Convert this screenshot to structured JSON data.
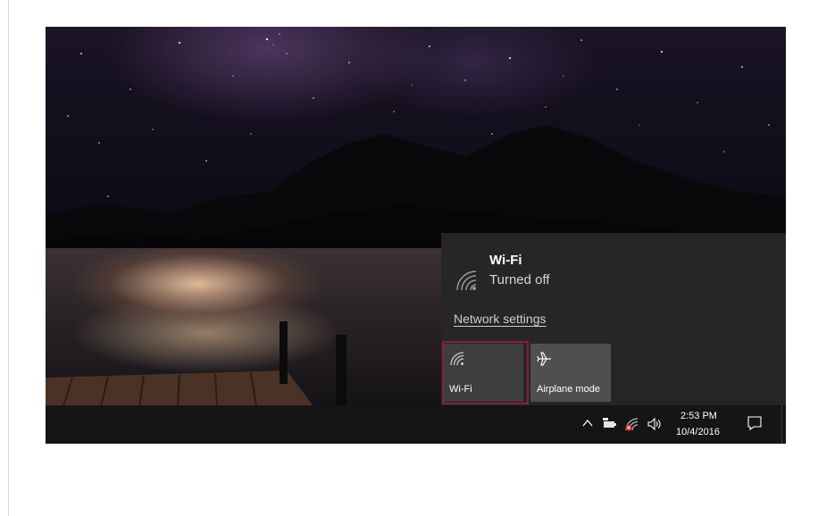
{
  "flyout": {
    "network_name": "Wi-Fi",
    "network_status": "Turned off",
    "settings_link": "Network settings",
    "tiles": [
      {
        "label": "Wi-Fi",
        "icon": "wifi-icon"
      },
      {
        "label": "Airplane mode",
        "icon": "airplane-icon"
      }
    ]
  },
  "taskbar": {
    "time": "2:53 PM",
    "date": "10/4/2016",
    "tray_icons": [
      "chevron-up-icon",
      "battery-icon",
      "wifi-off-icon",
      "volume-icon",
      "notifications-icon"
    ]
  },
  "colors": {
    "flyout_bg": "#262626",
    "tile_bg": "#4a4a4a",
    "taskbar_bg": "#151515",
    "highlight": "#8c1d3e",
    "network_off_badge": "#d9262c"
  }
}
